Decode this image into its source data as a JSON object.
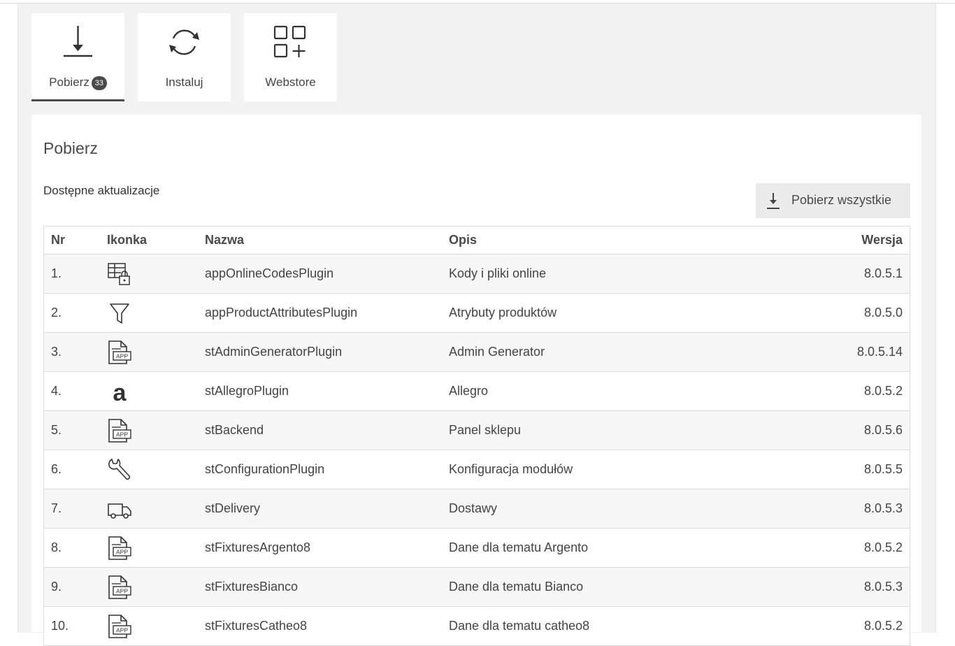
{
  "tabs": [
    {
      "label": "Pobierz",
      "badge": "33",
      "icon": "download-icon",
      "active": true
    },
    {
      "label": "Instaluj",
      "icon": "sync-icon",
      "active": false
    },
    {
      "label": "Webstore",
      "icon": "apps-add-icon",
      "active": false
    }
  ],
  "panel": {
    "title": "Pobierz",
    "subtitle": "Dostępne aktualizacje",
    "download_all_label": "Pobierz wszystkie"
  },
  "table": {
    "headers": {
      "nr": "Nr",
      "icon": "Ikonka",
      "name": "Nazwa",
      "desc": "Opis",
      "version": "Wersja"
    },
    "rows": [
      {
        "nr": "1.",
        "icon": "table-lock-icon",
        "name": "appOnlineCodesPlugin",
        "desc": "Kody i pliki online",
        "version": "8.0.5.1"
      },
      {
        "nr": "2.",
        "icon": "filter-icon",
        "name": "appProductAttributesPlugin",
        "desc": "Atrybuty produktów",
        "version": "8.0.5.0"
      },
      {
        "nr": "3.",
        "icon": "app-file-icon",
        "name": "stAdminGeneratorPlugin",
        "desc": "Admin Generator",
        "version": "8.0.5.14"
      },
      {
        "nr": "4.",
        "icon": "allegro-icon",
        "name": "stAllegroPlugin",
        "desc": "Allegro",
        "version": "8.0.5.2"
      },
      {
        "nr": "5.",
        "icon": "app-file-icon",
        "name": "stBackend",
        "desc": "Panel sklepu",
        "version": "8.0.5.6"
      },
      {
        "nr": "6.",
        "icon": "wrench-icon",
        "name": "stConfigurationPlugin",
        "desc": "Konfiguracja modułów",
        "version": "8.0.5.5"
      },
      {
        "nr": "7.",
        "icon": "truck-icon",
        "name": "stDelivery",
        "desc": "Dostawy",
        "version": "8.0.5.3"
      },
      {
        "nr": "8.",
        "icon": "app-file-icon",
        "name": "stFixturesArgento8",
        "desc": "Dane dla tematu Argento",
        "version": "8.0.5.2"
      },
      {
        "nr": "9.",
        "icon": "app-file-icon",
        "name": "stFixturesBianco",
        "desc": "Dane dla tematu Bianco",
        "version": "8.0.5.3"
      },
      {
        "nr": "10.",
        "icon": "app-file-icon",
        "name": "stFixturesCatheo8",
        "desc": "Dane dla tematu catheo8",
        "version": "8.0.5.2"
      }
    ]
  },
  "colors": {
    "page_bg": "#f2f2f2",
    "panel_bg": "#ffffff",
    "text": "#444444",
    "badge_bg": "#4a4a4a",
    "button_bg": "#ebebeb"
  }
}
